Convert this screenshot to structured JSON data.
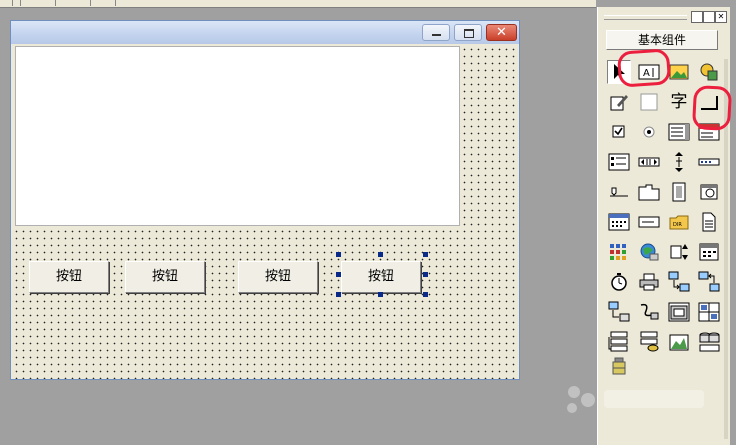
{
  "form": {
    "buttons": [
      {
        "label": "按钮"
      },
      {
        "label": "按钮"
      },
      {
        "label": "按钮"
      },
      {
        "label": "按钮"
      }
    ],
    "selected_button_index": 3
  },
  "toolbox": {
    "tab_title": "基本组件",
    "char_tool_glyph": "字",
    "tools": [
      "pointer-icon",
      "label-icon",
      "picture-icon",
      "shape-icon",
      "editbox-icon",
      "frame-icon",
      "font-char-icon",
      "button-icon",
      "checkbox-icon",
      "radio-icon",
      "listbox-icon",
      "combobox-icon",
      "listview-icon",
      "hscroll-icon",
      "vscroll-icon",
      "progress-icon",
      "slider-icon",
      "tabcontrol-icon",
      "filebox-icon",
      "timer-icon",
      "calendar-icon",
      "textbox-icon",
      "drivebox-icon",
      "document-icon",
      "grid-icon",
      "network-icon",
      "spinner-icon",
      "status-icon",
      "clock-icon",
      "printer-icon",
      "client-icon",
      "server-icon",
      "transfer-icon",
      "modem-icon",
      "window-icon",
      "split-icon",
      "database-icon",
      "dbfield-icon",
      "chart-icon",
      "odbc-icon",
      "bundle-icon"
    ]
  },
  "colors": {
    "annotation": "#ec1f3e",
    "selection_handle": "#0a2a8a"
  }
}
